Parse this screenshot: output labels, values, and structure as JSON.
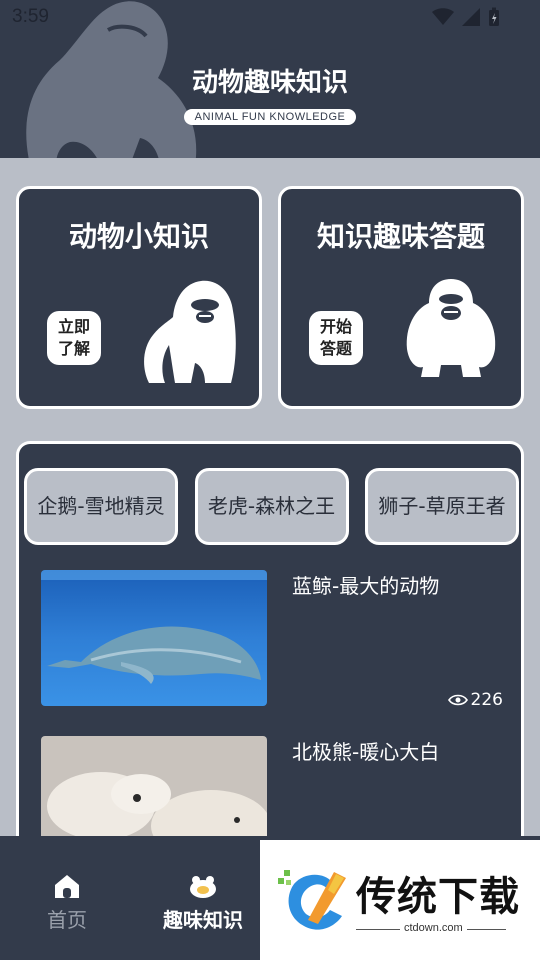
{
  "status_bar": {
    "time": "3:59"
  },
  "header": {
    "title": "动物趣味知识",
    "subtitle": "ANIMAL FUN KNOWLEDGE"
  },
  "cards": [
    {
      "title": "动物小知识",
      "button_label": "立即了解",
      "button_line1": "立即",
      "button_line2": "了解"
    },
    {
      "title": "知识趣味答题",
      "button_label": "开始答题",
      "button_line1": "开始",
      "button_line2": "答题"
    }
  ],
  "tags": [
    "企鹅-雪地精灵",
    "老虎-森林之王",
    "狮子-草原王者"
  ],
  "articles": [
    {
      "title": "蓝鲸-最大的动物",
      "views": "226"
    },
    {
      "title": "北极熊-暖心大白",
      "views": ""
    }
  ],
  "tabbar": {
    "items": [
      {
        "label": "首页",
        "icon": "home-icon"
      },
      {
        "label": "趣味知识",
        "icon": "fun-knowledge-icon"
      }
    ]
  },
  "watermark": {
    "brand": "传统下载",
    "url": "ctdown.com"
  },
  "colors": {
    "primary": "#333b4b",
    "background": "#b9bec7",
    "white": "#ffffff"
  }
}
